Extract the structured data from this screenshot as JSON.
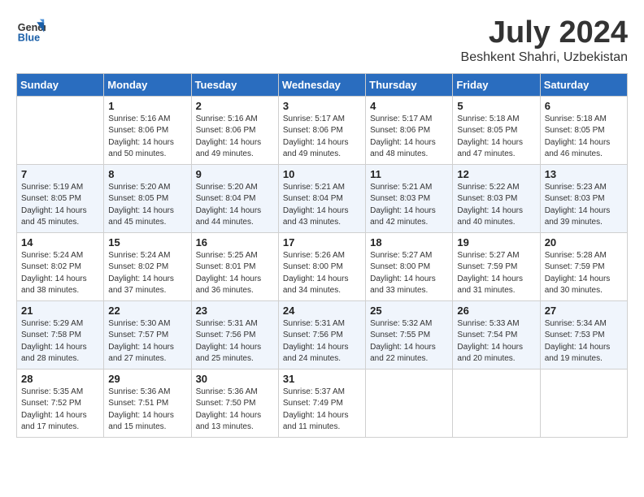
{
  "header": {
    "logo_general": "General",
    "logo_blue": "Blue",
    "month_year": "July 2024",
    "location": "Beshkent Shahri, Uzbekistan"
  },
  "weekdays": [
    "Sunday",
    "Monday",
    "Tuesday",
    "Wednesday",
    "Thursday",
    "Friday",
    "Saturday"
  ],
  "weeks": [
    [
      {
        "day": "",
        "content": ""
      },
      {
        "day": "1",
        "content": "Sunrise: 5:16 AM\nSunset: 8:06 PM\nDaylight: 14 hours\nand 50 minutes."
      },
      {
        "day": "2",
        "content": "Sunrise: 5:16 AM\nSunset: 8:06 PM\nDaylight: 14 hours\nand 49 minutes."
      },
      {
        "day": "3",
        "content": "Sunrise: 5:17 AM\nSunset: 8:06 PM\nDaylight: 14 hours\nand 49 minutes."
      },
      {
        "day": "4",
        "content": "Sunrise: 5:17 AM\nSunset: 8:06 PM\nDaylight: 14 hours\nand 48 minutes."
      },
      {
        "day": "5",
        "content": "Sunrise: 5:18 AM\nSunset: 8:05 PM\nDaylight: 14 hours\nand 47 minutes."
      },
      {
        "day": "6",
        "content": "Sunrise: 5:18 AM\nSunset: 8:05 PM\nDaylight: 14 hours\nand 46 minutes."
      }
    ],
    [
      {
        "day": "7",
        "content": "Sunrise: 5:19 AM\nSunset: 8:05 PM\nDaylight: 14 hours\nand 45 minutes."
      },
      {
        "day": "8",
        "content": "Sunrise: 5:20 AM\nSunset: 8:05 PM\nDaylight: 14 hours\nand 45 minutes."
      },
      {
        "day": "9",
        "content": "Sunrise: 5:20 AM\nSunset: 8:04 PM\nDaylight: 14 hours\nand 44 minutes."
      },
      {
        "day": "10",
        "content": "Sunrise: 5:21 AM\nSunset: 8:04 PM\nDaylight: 14 hours\nand 43 minutes."
      },
      {
        "day": "11",
        "content": "Sunrise: 5:21 AM\nSunset: 8:03 PM\nDaylight: 14 hours\nand 42 minutes."
      },
      {
        "day": "12",
        "content": "Sunrise: 5:22 AM\nSunset: 8:03 PM\nDaylight: 14 hours\nand 40 minutes."
      },
      {
        "day": "13",
        "content": "Sunrise: 5:23 AM\nSunset: 8:03 PM\nDaylight: 14 hours\nand 39 minutes."
      }
    ],
    [
      {
        "day": "14",
        "content": "Sunrise: 5:24 AM\nSunset: 8:02 PM\nDaylight: 14 hours\nand 38 minutes."
      },
      {
        "day": "15",
        "content": "Sunrise: 5:24 AM\nSunset: 8:02 PM\nDaylight: 14 hours\nand 37 minutes."
      },
      {
        "day": "16",
        "content": "Sunrise: 5:25 AM\nSunset: 8:01 PM\nDaylight: 14 hours\nand 36 minutes."
      },
      {
        "day": "17",
        "content": "Sunrise: 5:26 AM\nSunset: 8:00 PM\nDaylight: 14 hours\nand 34 minutes."
      },
      {
        "day": "18",
        "content": "Sunrise: 5:27 AM\nSunset: 8:00 PM\nDaylight: 14 hours\nand 33 minutes."
      },
      {
        "day": "19",
        "content": "Sunrise: 5:27 AM\nSunset: 7:59 PM\nDaylight: 14 hours\nand 31 minutes."
      },
      {
        "day": "20",
        "content": "Sunrise: 5:28 AM\nSunset: 7:59 PM\nDaylight: 14 hours\nand 30 minutes."
      }
    ],
    [
      {
        "day": "21",
        "content": "Sunrise: 5:29 AM\nSunset: 7:58 PM\nDaylight: 14 hours\nand 28 minutes."
      },
      {
        "day": "22",
        "content": "Sunrise: 5:30 AM\nSunset: 7:57 PM\nDaylight: 14 hours\nand 27 minutes."
      },
      {
        "day": "23",
        "content": "Sunrise: 5:31 AM\nSunset: 7:56 PM\nDaylight: 14 hours\nand 25 minutes."
      },
      {
        "day": "24",
        "content": "Sunrise: 5:31 AM\nSunset: 7:56 PM\nDaylight: 14 hours\nand 24 minutes."
      },
      {
        "day": "25",
        "content": "Sunrise: 5:32 AM\nSunset: 7:55 PM\nDaylight: 14 hours\nand 22 minutes."
      },
      {
        "day": "26",
        "content": "Sunrise: 5:33 AM\nSunset: 7:54 PM\nDaylight: 14 hours\nand 20 minutes."
      },
      {
        "day": "27",
        "content": "Sunrise: 5:34 AM\nSunset: 7:53 PM\nDaylight: 14 hours\nand 19 minutes."
      }
    ],
    [
      {
        "day": "28",
        "content": "Sunrise: 5:35 AM\nSunset: 7:52 PM\nDaylight: 14 hours\nand 17 minutes."
      },
      {
        "day": "29",
        "content": "Sunrise: 5:36 AM\nSunset: 7:51 PM\nDaylight: 14 hours\nand 15 minutes."
      },
      {
        "day": "30",
        "content": "Sunrise: 5:36 AM\nSunset: 7:50 PM\nDaylight: 14 hours\nand 13 minutes."
      },
      {
        "day": "31",
        "content": "Sunrise: 5:37 AM\nSunset: 7:49 PM\nDaylight: 14 hours\nand 11 minutes."
      },
      {
        "day": "",
        "content": ""
      },
      {
        "day": "",
        "content": ""
      },
      {
        "day": "",
        "content": ""
      }
    ]
  ]
}
